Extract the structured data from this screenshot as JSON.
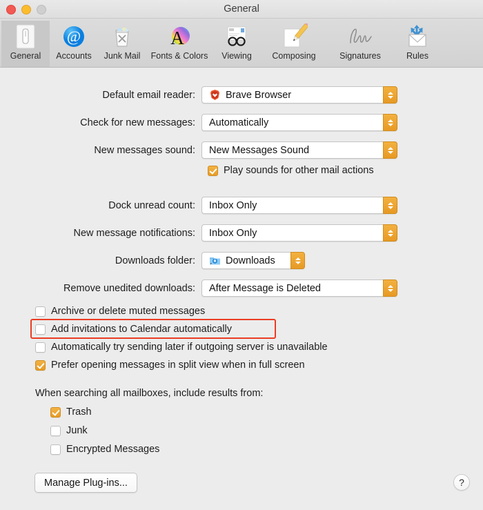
{
  "window": {
    "title": "General",
    "controls": [
      {
        "name": "close",
        "color": "#f25a53"
      },
      {
        "name": "minimize",
        "color": "#fbbd2e"
      },
      {
        "name": "zoom",
        "color": "#cfcfcf"
      }
    ]
  },
  "toolbar": {
    "items": [
      {
        "label": "General",
        "icon": "general-switch-icon",
        "selected": true
      },
      {
        "label": "Accounts",
        "icon": "at-sign-icon",
        "selected": false
      },
      {
        "label": "Junk Mail",
        "icon": "trash-bin-icon",
        "selected": false
      },
      {
        "label": "Fonts & Colors",
        "icon": "color-wheel-a-icon",
        "selected": false
      },
      {
        "label": "Viewing",
        "icon": "eyeglasses-icon",
        "selected": false
      },
      {
        "label": "Composing",
        "icon": "pencil-note-icon",
        "selected": false
      },
      {
        "label": "Signatures",
        "icon": "signature-icon",
        "selected": false
      },
      {
        "label": "Rules",
        "icon": "envelope-arrows-icon",
        "selected": false
      }
    ]
  },
  "form": {
    "default_email_reader": {
      "label": "Default email reader:",
      "value": "Brave Browser",
      "icon": "brave-browser-icon"
    },
    "check_new_messages": {
      "label": "Check for new messages:",
      "value": "Automatically"
    },
    "new_messages_sound": {
      "label": "New messages sound:",
      "value": "New Messages Sound"
    },
    "play_sounds": {
      "label": "Play sounds for other mail actions",
      "checked": true
    },
    "dock_unread_count": {
      "label": "Dock unread count:",
      "value": "Inbox Only"
    },
    "new_message_notifications": {
      "label": "New message notifications:",
      "value": "Inbox Only"
    },
    "downloads_folder": {
      "label": "Downloads folder:",
      "value": "Downloads",
      "icon": "downloads-folder-icon"
    },
    "remove_unedited_downloads": {
      "label": "Remove unedited downloads:",
      "value": "After Message is Deleted"
    }
  },
  "options": [
    {
      "label": "Archive or delete muted messages",
      "checked": false,
      "highlighted": false
    },
    {
      "label": "Add invitations to Calendar automatically",
      "checked": false,
      "highlighted": true
    },
    {
      "label": "Automatically try sending later if outgoing server is unavailable",
      "checked": false,
      "highlighted": false
    },
    {
      "label": "Prefer opening messages in split view when in full screen",
      "checked": true,
      "highlighted": false
    }
  ],
  "search_section": {
    "title": "When searching all mailboxes, include results from:",
    "options": [
      {
        "label": "Trash",
        "checked": true
      },
      {
        "label": "Junk",
        "checked": false
      },
      {
        "label": "Encrypted Messages",
        "checked": false
      }
    ]
  },
  "footer": {
    "manage_plugins": "Manage Plug-ins...",
    "help": "?"
  },
  "colors": {
    "accent_orange": "#e89c25",
    "highlight_red": "#ec3c22",
    "window_bg": "#ececec"
  }
}
